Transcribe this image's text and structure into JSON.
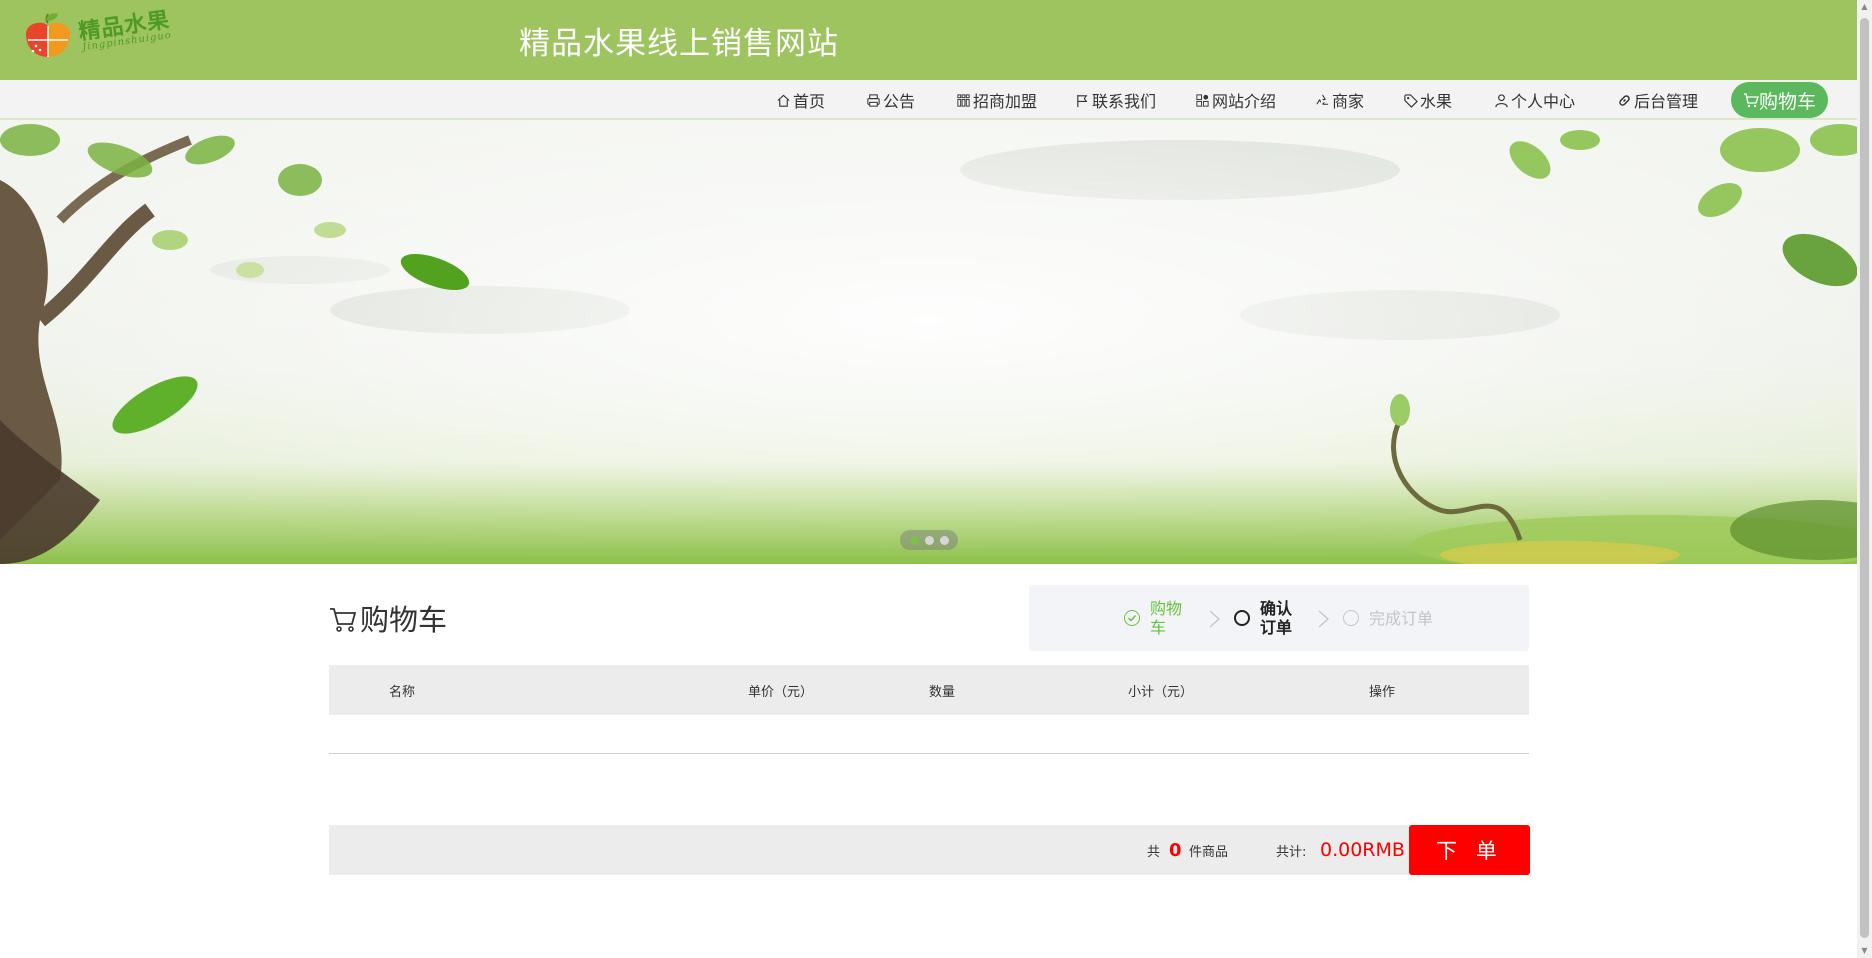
{
  "header": {
    "logo_text": "精品水果",
    "logo_sub": "Jingpinshuiguo",
    "site_title": "精品水果线上销售网站"
  },
  "nav": {
    "items": [
      {
        "label": "首页",
        "icon": "home-icon"
      },
      {
        "label": "公告",
        "icon": "printer-icon"
      },
      {
        "label": "招商加盟",
        "icon": "grid-icon"
      },
      {
        "label": "联系我们",
        "icon": "flag-icon"
      },
      {
        "label": "网站介绍",
        "icon": "apps-icon"
      },
      {
        "label": "商家",
        "icon": "recycle-icon"
      },
      {
        "label": "水果",
        "icon": "tag-icon"
      },
      {
        "label": "个人中心",
        "icon": "user-icon"
      },
      {
        "label": "后台管理",
        "icon": "link-icon"
      }
    ],
    "cart_label": "购物车",
    "cart_icon": "cart-icon"
  },
  "banner": {
    "slides": 3,
    "active_slide": 1
  },
  "cart": {
    "title": "购物车",
    "steps": [
      {
        "label": "购物车",
        "status": "done"
      },
      {
        "label": "确认订单",
        "status": "current"
      },
      {
        "label": "完成订单",
        "status": "pending"
      }
    ],
    "columns": [
      "名称",
      "单价（元）",
      "数量",
      "小计（元）",
      "操作"
    ],
    "rows": [],
    "footer": {
      "count_prefix": "共",
      "count": "0",
      "count_suffix": "件商品",
      "total_label": "共计:",
      "total_amount": "0.00RMB",
      "order_button": "下 单"
    }
  },
  "colors": {
    "header_bg": "#9dc45f",
    "nav_bg": "#f3f3f3",
    "cart_button": "#5cb85c",
    "step_done": "#67c23a",
    "accent_red": "#ff0000"
  }
}
